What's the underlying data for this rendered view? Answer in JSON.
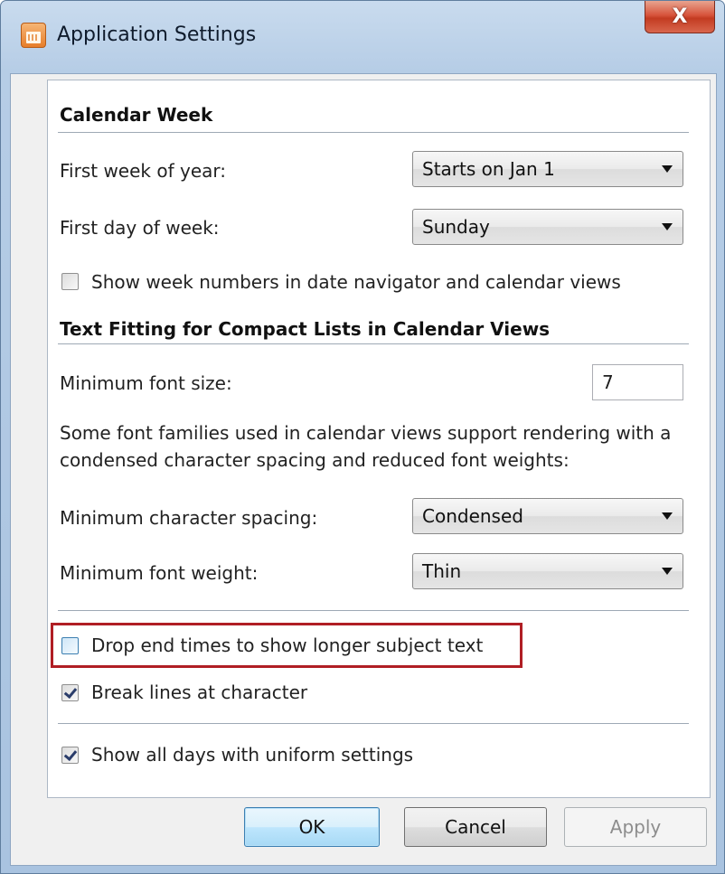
{
  "window": {
    "title": "Application Settings",
    "close_glyph": "X",
    "icon": "calendar-app-icon"
  },
  "calendar_week": {
    "header": "Calendar Week",
    "first_week_label": "First week of year:",
    "first_week_value": "Starts on Jan 1",
    "first_day_label": "First day of week:",
    "first_day_value": "Sunday",
    "week_numbers_label": "Show week numbers in date navigator and calendar views",
    "week_numbers_checked": false
  },
  "text_fitting": {
    "header": "Text Fitting for Compact Lists in Calendar Views",
    "min_font_size_label": "Minimum font size:",
    "min_font_size_value": "7",
    "description": "Some font families used in calendar views support rendering with a condensed character spacing and reduced font weights:",
    "min_char_spacing_label": "Minimum character spacing:",
    "min_char_spacing_value": "Condensed",
    "min_font_weight_label": "Minimum font weight:",
    "min_font_weight_value": "Thin"
  },
  "options": {
    "drop_end_times_label": "Drop end times to show longer subject text",
    "drop_end_times_checked": false,
    "break_lines_label": "Break lines at character",
    "break_lines_checked": true,
    "uniform_settings_label": "Show all days with uniform settings",
    "uniform_settings_checked": true
  },
  "buttons": {
    "ok": "OK",
    "cancel": "Cancel",
    "apply": "Apply"
  },
  "colors": {
    "highlight": "#b01e24",
    "close_button": "#c33b21",
    "default_button_border": "#3c7fb1"
  }
}
